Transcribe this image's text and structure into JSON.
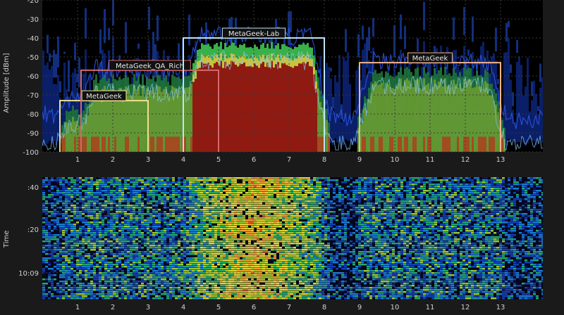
{
  "chart_data": [
    {
      "type": "area",
      "panel": "spectrum",
      "ylabel": "Amplitude [dBm]",
      "ylim": [
        -100,
        -20
      ],
      "xlim": [
        0,
        14.2
      ],
      "yticks": [
        "-20",
        "-30",
        "-40",
        "-50",
        "-60",
        "-70",
        "-80",
        "-90",
        "-100"
      ],
      "ytick_values": [
        -20,
        -30,
        -40,
        -50,
        -60,
        -70,
        -80,
        -90,
        -100
      ],
      "xticks": [
        "1",
        "2",
        "3",
        "4",
        "5",
        "6",
        "7",
        "8",
        "9",
        "10",
        "11",
        "12",
        "13"
      ],
      "xtick_values": [
        1,
        2,
        3,
        4,
        5,
        6,
        7,
        8,
        9,
        10,
        11,
        12,
        13
      ],
      "grid": true,
      "networks": [
        {
          "name": "MetaGeek",
          "x_start": 0.5,
          "x_end": 3.0,
          "amplitude": -73,
          "color": "#f2e08a"
        },
        {
          "name": "MetaGeek_QA_Rich",
          "x_start": 1.1,
          "x_end": 5.0,
          "amplitude": -57,
          "color": "#d26a6a"
        },
        {
          "name": "MetaGeek-Lab",
          "x_start": 4.0,
          "x_end": 8.0,
          "amplitude": -40,
          "color": "#bfe4f2"
        },
        {
          "name": "MetaGeek",
          "x_start": 9.0,
          "x_end": 13.0,
          "amplitude": -53,
          "color": "#f3b48a"
        }
      ]
    },
    {
      "type": "heatmap",
      "panel": "waterfall",
      "ylabel": "Time",
      "yticks": [
        ":40",
        ":20",
        "10:09"
      ],
      "xticks": [
        "1",
        "2",
        "3",
        "4",
        "5",
        "6",
        "7",
        "8",
        "9",
        "10",
        "11",
        "12",
        "13"
      ],
      "xtick_values": [
        1,
        2,
        3,
        4,
        5,
        6,
        7,
        8,
        9,
        10,
        11,
        12,
        13
      ]
    }
  ],
  "colors": {
    "background": "#1a1a1a",
    "plot_background": "#000000",
    "grid": "#3a3a3a"
  }
}
